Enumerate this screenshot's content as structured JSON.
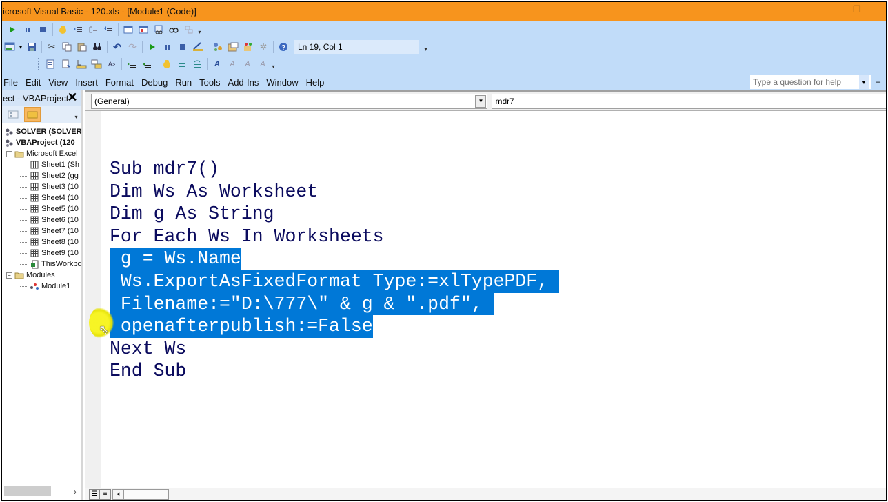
{
  "window": {
    "title": "icrosoft Visual Basic - 120.xls - [Module1 (Code)]",
    "minimize_icon": "—",
    "restore_icon": "❐"
  },
  "toolbars": {
    "debug": [
      "run-icon",
      "break-icon",
      "reset-icon",
      "toggle-breakpoint-icon",
      "step-into-icon",
      "step-over-icon",
      "step-out-icon",
      "locals-window-icon",
      "immediate-window-icon",
      "watch-window-icon",
      "quick-watch-icon",
      "call-stack-icon"
    ],
    "standard": [
      "view-excel-icon",
      "insert-module-icon",
      "save-icon",
      "cut-icon",
      "copy-icon",
      "paste-icon",
      "find-icon",
      "undo-icon",
      "redo-icon",
      "run-icon",
      "break-icon",
      "reset-icon",
      "design-mode-icon",
      "project-explorer-icon",
      "properties-window-icon",
      "object-browser-icon",
      "toolbox-icon",
      "help-icon"
    ],
    "edit": [
      "list-properties-icon",
      "list-constants-icon",
      "quick-info-icon",
      "parameter-info-icon",
      "complete-word-icon",
      "indent-icon",
      "outdent-icon",
      "toggle-breakpoint-icon",
      "comment-block-icon",
      "uncomment-block-icon",
      "toggle-bookmark-icon",
      "next-bookmark-icon",
      "previous-bookmark-icon",
      "clear-bookmarks-icon"
    ],
    "cursor_position": "Ln 19, Col 1"
  },
  "menu": [
    "File",
    "Edit",
    "View",
    "Insert",
    "Format",
    "Debug",
    "Run",
    "Tools",
    "Add-Ins",
    "Window",
    "Help"
  ],
  "help_box": {
    "placeholder": "Type a question for help"
  },
  "project_explorer": {
    "title": "ect - VBAProject",
    "close_icon": "✕",
    "tree": [
      {
        "label": "SOLVER (SOLVER",
        "level": 0,
        "icon": "vba-project-icon",
        "bold": true
      },
      {
        "label": "VBAProject (120",
        "level": 0,
        "icon": "vba-project-icon",
        "bold": true
      },
      {
        "label": "Microsoft Excel",
        "level": 1,
        "icon": "folder-icon",
        "expander": "−"
      },
      {
        "label": "Sheet1 (Sh",
        "level": 2,
        "icon": "sheet-icon"
      },
      {
        "label": "Sheet2 (gg",
        "level": 2,
        "icon": "sheet-icon"
      },
      {
        "label": "Sheet3 (10",
        "level": 2,
        "icon": "sheet-icon"
      },
      {
        "label": "Sheet4 (10",
        "level": 2,
        "icon": "sheet-icon"
      },
      {
        "label": "Sheet5 (10",
        "level": 2,
        "icon": "sheet-icon"
      },
      {
        "label": "Sheet6 (10",
        "level": 2,
        "icon": "sheet-icon"
      },
      {
        "label": "Sheet7 (10",
        "level": 2,
        "icon": "sheet-icon"
      },
      {
        "label": "Sheet8 (10",
        "level": 2,
        "icon": "sheet-icon"
      },
      {
        "label": "Sheet9 (10",
        "level": 2,
        "icon": "sheet-icon"
      },
      {
        "label": "ThisWorkbc",
        "level": 2,
        "icon": "workbook-icon"
      },
      {
        "label": "Modules",
        "level": 1,
        "icon": "folder-icon",
        "expander": "−"
      },
      {
        "label": "Module1",
        "level": 2,
        "icon": "module-icon"
      }
    ],
    "scroll_right": "›"
  },
  "code_window": {
    "object_combo": "(General)",
    "procedure_combo": "mdr7",
    "lines": [
      {
        "text": "Sub mdr7()",
        "selected": false
      },
      {
        "text": "Dim Ws As Worksheet",
        "selected": false
      },
      {
        "text": "Dim g As String",
        "selected": false
      },
      {
        "text": "For Each Ws In Worksheets",
        "selected": false
      },
      {
        "text": " g = Ws.Name",
        "selected": true
      },
      {
        "text": " Ws.ExportAsFixedFormat Type:=xlTypePDF, ",
        "selected": true
      },
      {
        "text": " Filename:=\"D:\\777\\\" & g & \".pdf\", ",
        "selected": true
      },
      {
        "text": " openafterpublish:=False",
        "selected": true
      },
      {
        "text": "Next Ws",
        "selected": false
      },
      {
        "text": "End Sub",
        "selected": false
      }
    ],
    "selection_color": "#0078d7",
    "code_color": "#0b0b5e"
  },
  "colors": {
    "titlebar": "#f7941d",
    "chrome": "#c1dcf9"
  }
}
